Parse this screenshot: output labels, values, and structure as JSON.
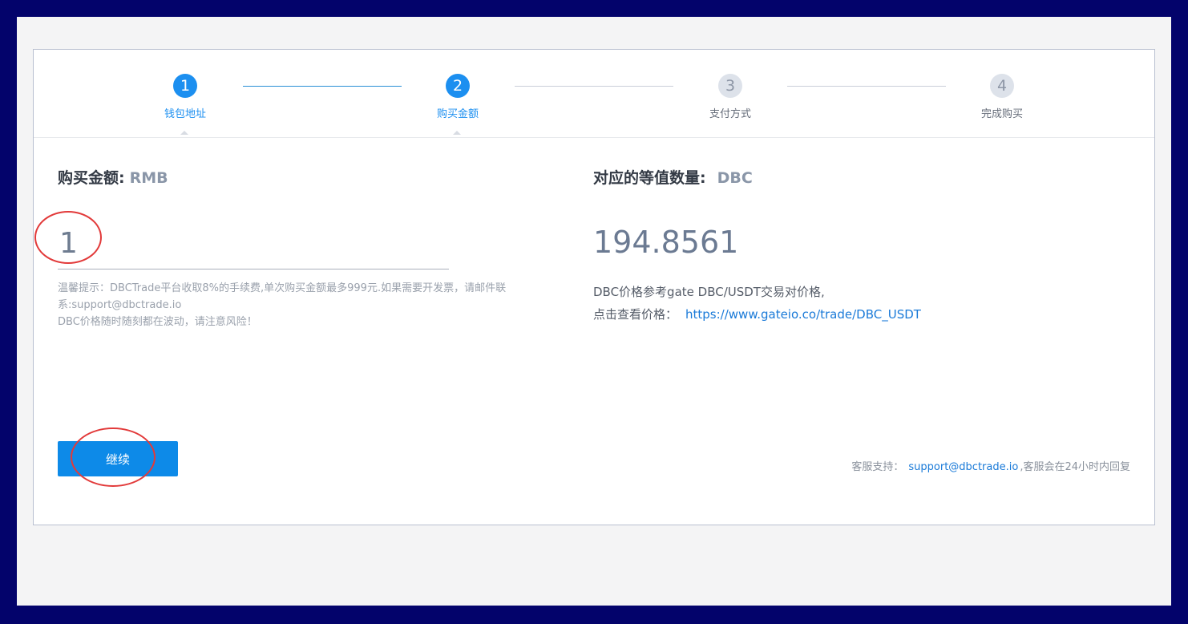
{
  "steps": [
    {
      "num": "1",
      "label": "钱包地址",
      "state": "active"
    },
    {
      "num": "2",
      "label": "购买金额",
      "state": "active"
    },
    {
      "num": "3",
      "label": "支付方式",
      "state": "todo"
    },
    {
      "num": "4",
      "label": "完成购买",
      "state": "todo"
    }
  ],
  "left": {
    "heading": "购买金额:",
    "unit": "RMB",
    "amount_value": "1",
    "tip_line1": "温馨提示：DBCTrade平台收取8%的手续费,单次购买金额最多999元.如果需要开发票，请邮件联系:support@dbctrade.io",
    "tip_line2": "DBC价格随时随刻都在波动，请注意风险！",
    "continue_label": "继续"
  },
  "right": {
    "heading": "对应的等值数量:",
    "unit": "DBC",
    "value": "194.8561",
    "ref_line1": "DBC价格参考gate DBC/USDT交易对价格,",
    "ref_line2_label": "点击查看价格：",
    "ref_link": "https://www.gateio.co/trade/DBC_USDT"
  },
  "support": {
    "label": "客服支持：",
    "email": "support@dbctrade.io",
    "suffix": ",客服会在24小时内回复"
  },
  "colors": {
    "frame": "#03036b",
    "accent": "#1c8ff0",
    "annotation": "#e23a3a"
  }
}
